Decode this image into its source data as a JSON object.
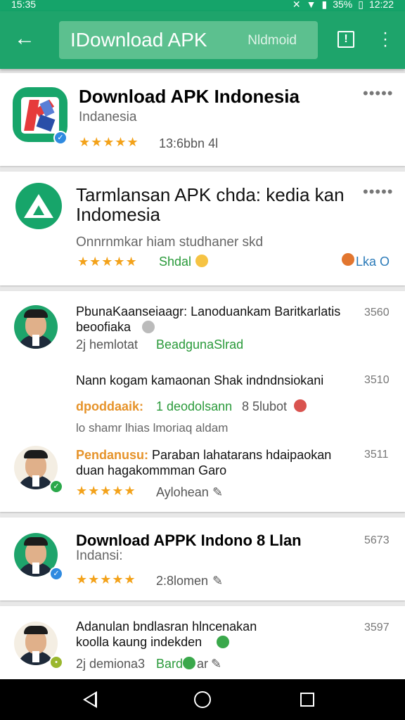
{
  "status_bar": {
    "time": "15:35",
    "battery": "35%",
    "clock_right": "12:22"
  },
  "toolbar": {
    "back_icon": "arrow-back-icon",
    "query": "IDownload APK",
    "hint": "Nldmoid",
    "report_icon": "report-icon",
    "more_icon": "more-vert-icon"
  },
  "results": [
    {
      "title": "Download APK Indonesia",
      "subtitle": "Indanesia",
      "stars": "★★★★★",
      "meta": "13:6bbn 4l",
      "menu": "•••••"
    },
    {
      "title_line1": "Tarmlansan APK chda: kedia kan",
      "title_line2": "Indomesia",
      "subtitle": "Onnrnmkar hiam studhaner skd",
      "stars": "★★★★★",
      "meta": "Shdal",
      "right_meta": "Lka O",
      "menu": "•••••"
    },
    {
      "line1": "PbunaKaanseiaagr: Lanoduankam Baritkarlatis",
      "line2": "beoofiaka",
      "meta_left": "2j hemlotat",
      "meta_green": "BeadgunaSlrad",
      "num": "3560"
    },
    {
      "line1": "Nann kogam kamaonan Shak indndnsiokani",
      "num": "3510",
      "orange_label": "dpoddaaik:",
      "mid": "1 deodolsann",
      "meta_right": "8 5lubot",
      "line3": "lo shamr lhias lmoriaq aldam"
    },
    {
      "prefix": "Pendanusu:",
      "line1": "Paraban lahatarans hdaipaokan",
      "line2": "duan hagakommman Garo",
      "num": "3511",
      "stars": "★★★★★",
      "meta": "Aylohean"
    },
    {
      "title": "Download APPK Indono 8 Llan",
      "subtitle": "Indansi:",
      "stars": "★★★★★",
      "meta": "2:8lomen",
      "num": "5673"
    },
    {
      "line1": "Adanulan bndlasran hlncenakan",
      "line2": "koolla kaung indekden",
      "meta_left": "2j demiona3",
      "meta_green": "Bard",
      "meta_after": "ar",
      "num": "3597"
    }
  ]
}
